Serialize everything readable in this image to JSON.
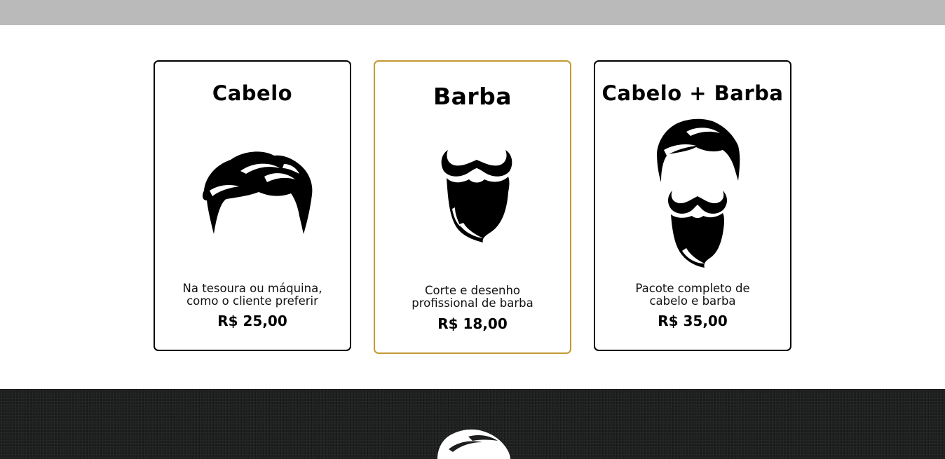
{
  "services": [
    {
      "title": "Cabelo",
      "description_line1": "Na tesoura ou máquina,",
      "description_line2": "como o cliente preferir",
      "price": "R$ 25,00",
      "icon": "hair-icon"
    },
    {
      "title": "Barba",
      "description_line1": "Corte e desenho",
      "description_line2": "profissional de barba",
      "price": "R$ 18,00",
      "icon": "beard-icon"
    },
    {
      "title": "Cabelo + Barba",
      "description_line1": "Pacote completo de",
      "description_line2": "cabelo e barba",
      "price": "R$ 35,00",
      "icon": "hair-and-beard-icon"
    }
  ],
  "colors": {
    "top_bar": "#bababa",
    "featured_border": "#c49a33",
    "card_border": "#000000",
    "footer_background": "#1e1f1f"
  },
  "footer": {
    "logo_icon": "barber-logo-icon"
  }
}
